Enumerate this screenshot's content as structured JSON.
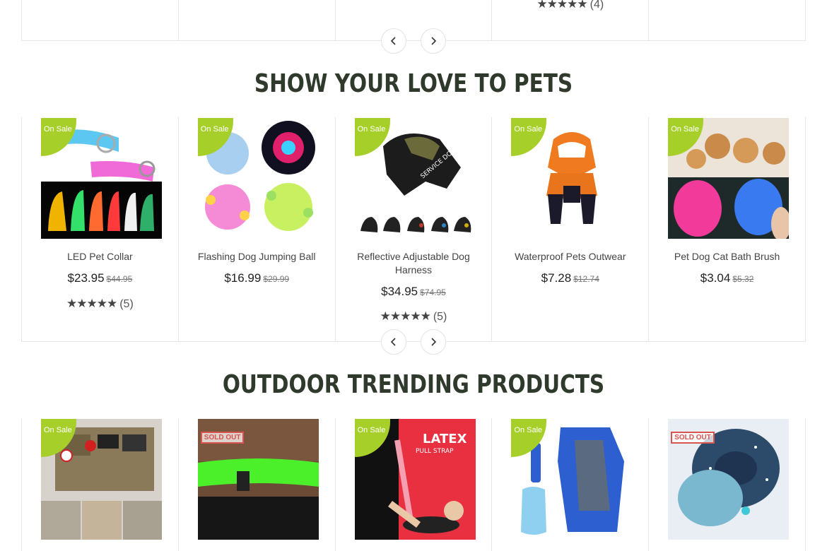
{
  "top_row": {
    "rating": {
      "stars": "★★★★★",
      "count": "(4)"
    }
  },
  "sections": {
    "pets_title": "SHOW YOUR LOVE TO PETS",
    "outdoor_title": "OUTDOOR TRENDING PRODUCTS"
  },
  "badges": {
    "on_sale": "On Sale",
    "sold_out": "SOLD OUT"
  },
  "pets": [
    {
      "name": "LED Pet Collar",
      "price": "$23.95",
      "old_price": "$44.95",
      "stars": "★★★★★",
      "count": "(5)"
    },
    {
      "name": "Flashing Dog Jumping Ball",
      "price": "$16.99",
      "old_price": "$29.99"
    },
    {
      "name": "Reflective Adjustable Dog Harness",
      "price": "$34.95",
      "old_price": "$74.95",
      "stars": "★★★★★",
      "count": "(5)"
    },
    {
      "name": "Waterproof Pets Outwear",
      "price": "$7.28",
      "old_price": "$12.74"
    },
    {
      "name": "Pet Dog Cat Bath Brush",
      "price": "$3.04",
      "old_price": "$5.32"
    }
  ],
  "outdoor_images": {
    "latex_title": "LATEX",
    "latex_sub": "PULL STRAP"
  },
  "icons": {
    "prev": "chevron-left-icon",
    "next": "chevron-right-icon",
    "star": "star-icon"
  },
  "colors": {
    "accent_green": "#a6cf2a",
    "title": "#2f3a2c",
    "sold_out_red": "#d9534f"
  }
}
